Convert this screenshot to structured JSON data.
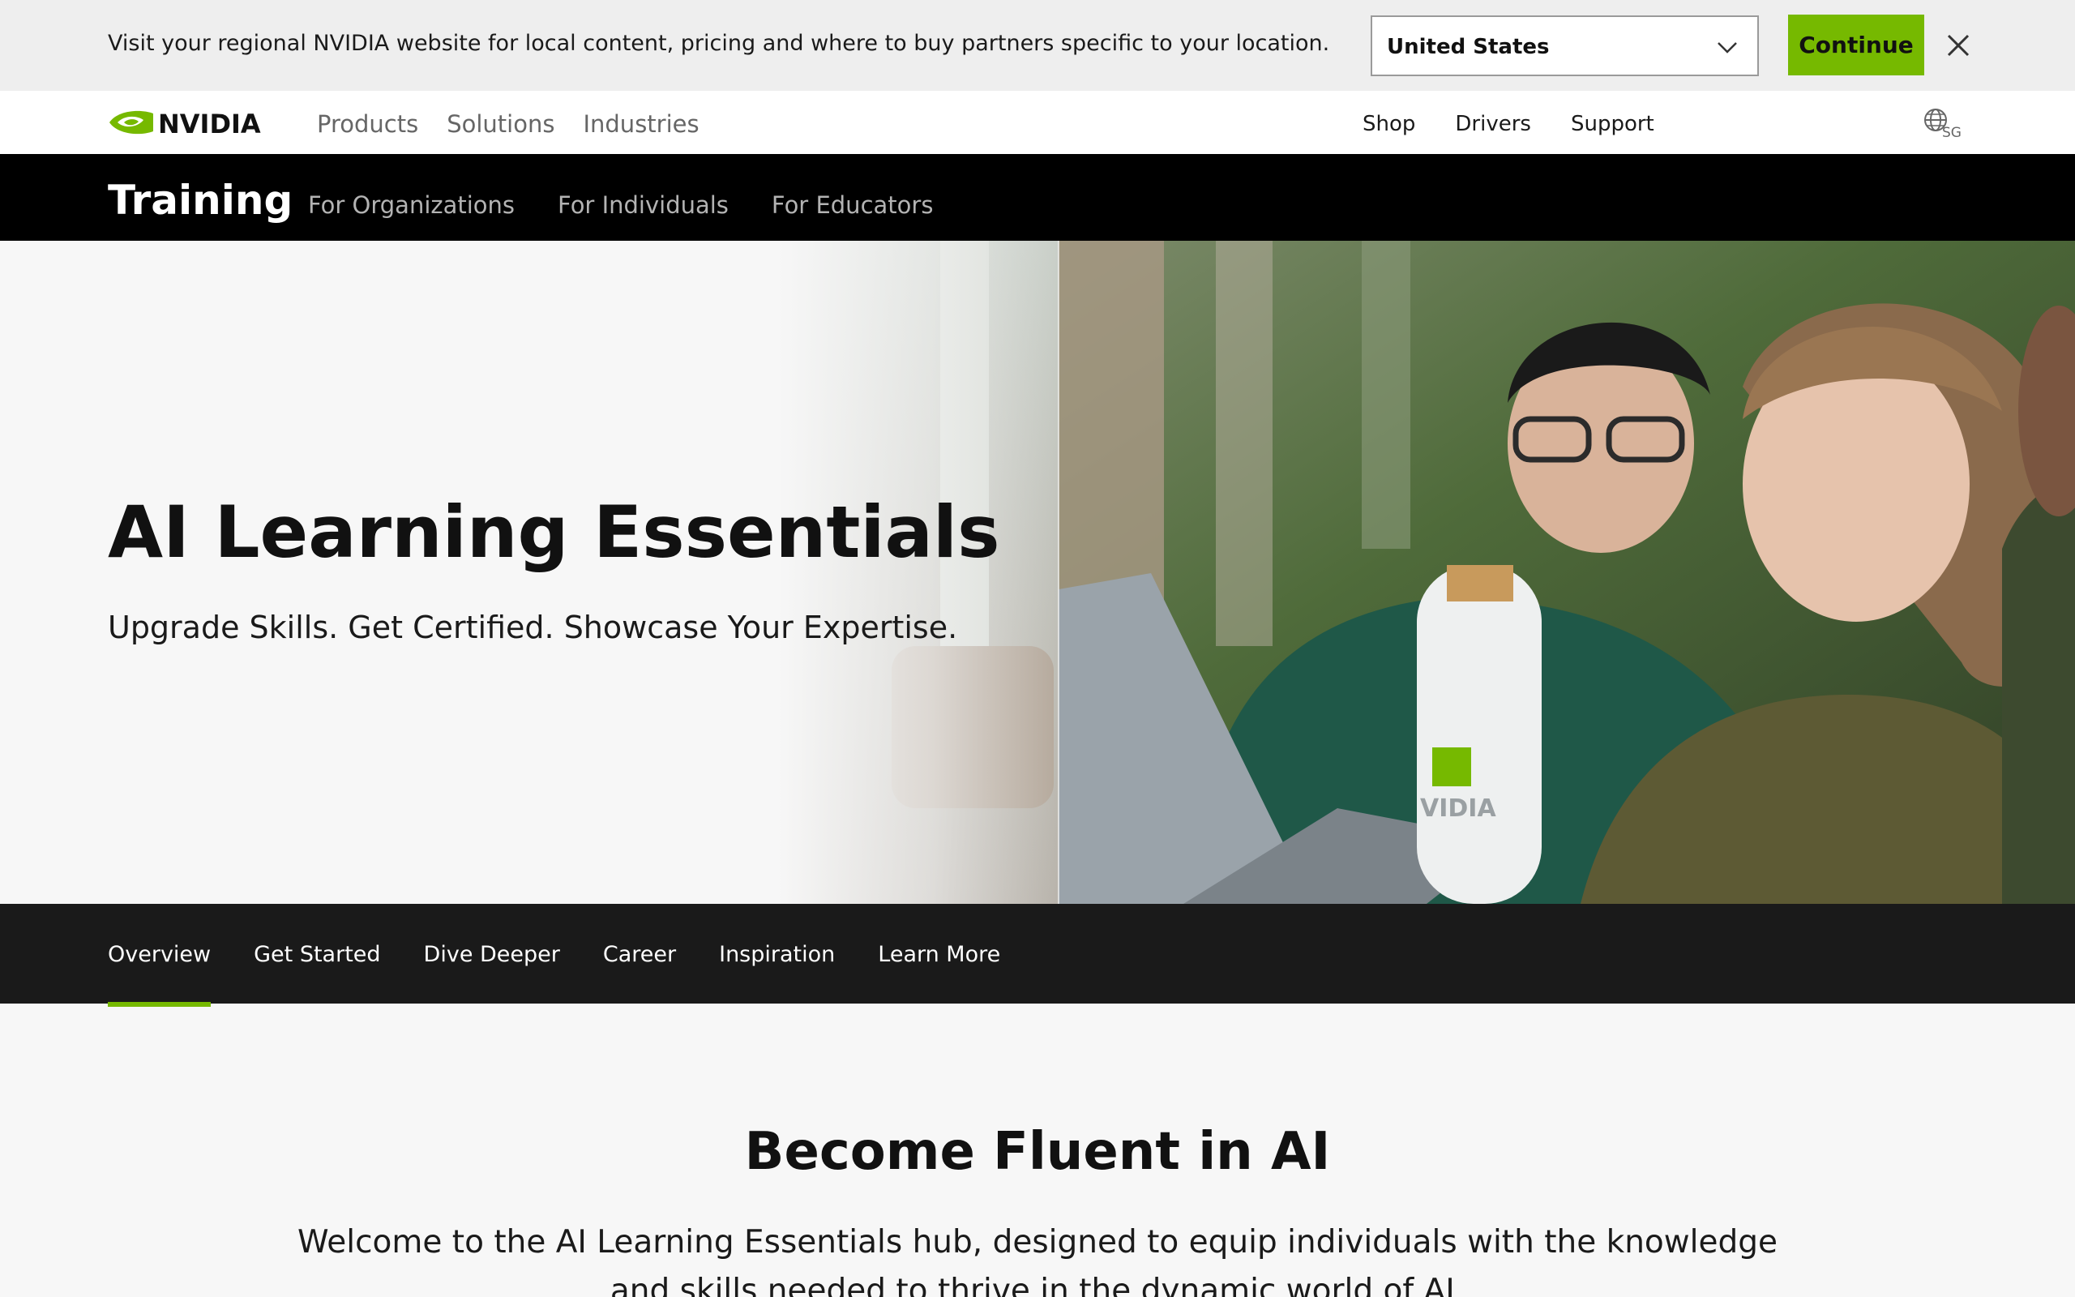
{
  "region_banner": {
    "message": "Visit your regional NVIDIA website for local content, pricing and where to buy partners specific to your location.",
    "selected_region": "United States",
    "continue_label": "Continue"
  },
  "main_nav": {
    "brand": "NVIDIA",
    "left_items": [
      "Products",
      "Solutions",
      "Industries"
    ],
    "right_items": [
      "Shop",
      "Drivers",
      "Support"
    ],
    "locale": "SG"
  },
  "training_nav": {
    "title": "Training",
    "links": [
      "For Organizations",
      "For Individuals",
      "For Educators"
    ]
  },
  "hero": {
    "title": "AI Learning Essentials",
    "subtitle": "Upgrade Skills. Get Certified. Showcase Your Expertise.",
    "image_description_icon": "hero-photo-icon"
  },
  "section_nav": {
    "tabs": [
      "Overview",
      "Get Started",
      "Dive Deeper",
      "Career",
      "Inspiration",
      "Learn More"
    ],
    "active_index": 0
  },
  "content": {
    "title": "Become Fluent in AI",
    "body": "Welcome to the AI Learning Essentials hub, designed to equip individuals with the knowledge and skills needed to thrive in the dynamic world of AI."
  },
  "colors": {
    "accent": "#76b900",
    "nav_dark": "#000000",
    "section_dark": "#1a1a1a"
  }
}
